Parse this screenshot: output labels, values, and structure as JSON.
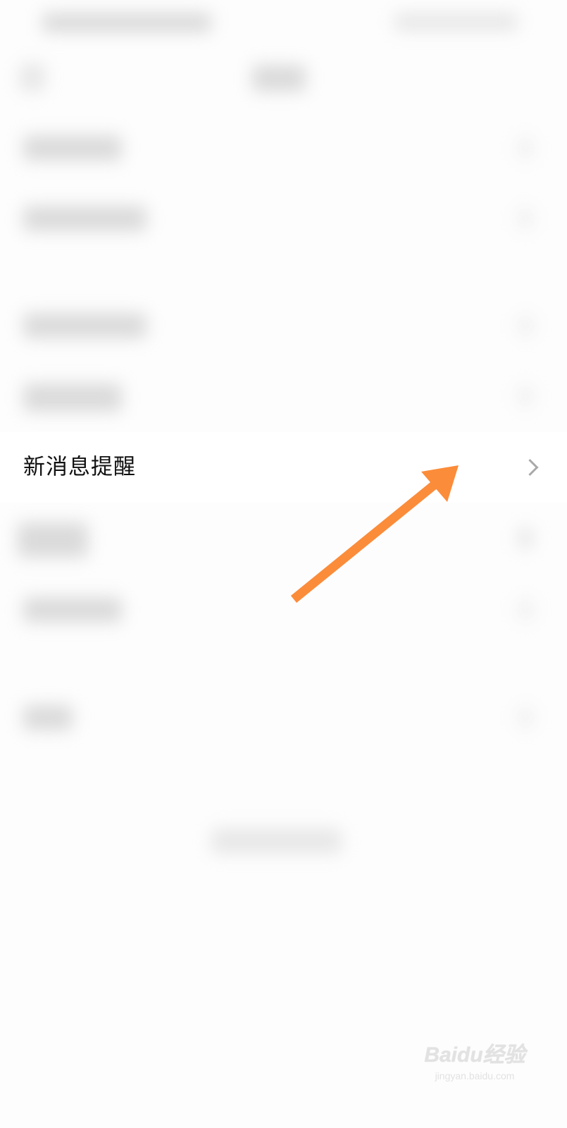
{
  "settings": {
    "focused_item": {
      "label": "新消息提醒",
      "icon": "chevron-right-icon"
    }
  },
  "annotation": {
    "arrow_color": "#fb8c3a",
    "arrow_icon": "arrow-up-right-icon"
  },
  "watermark": {
    "logo": "Baidu经验",
    "url": "jingyan.baidu.com"
  }
}
